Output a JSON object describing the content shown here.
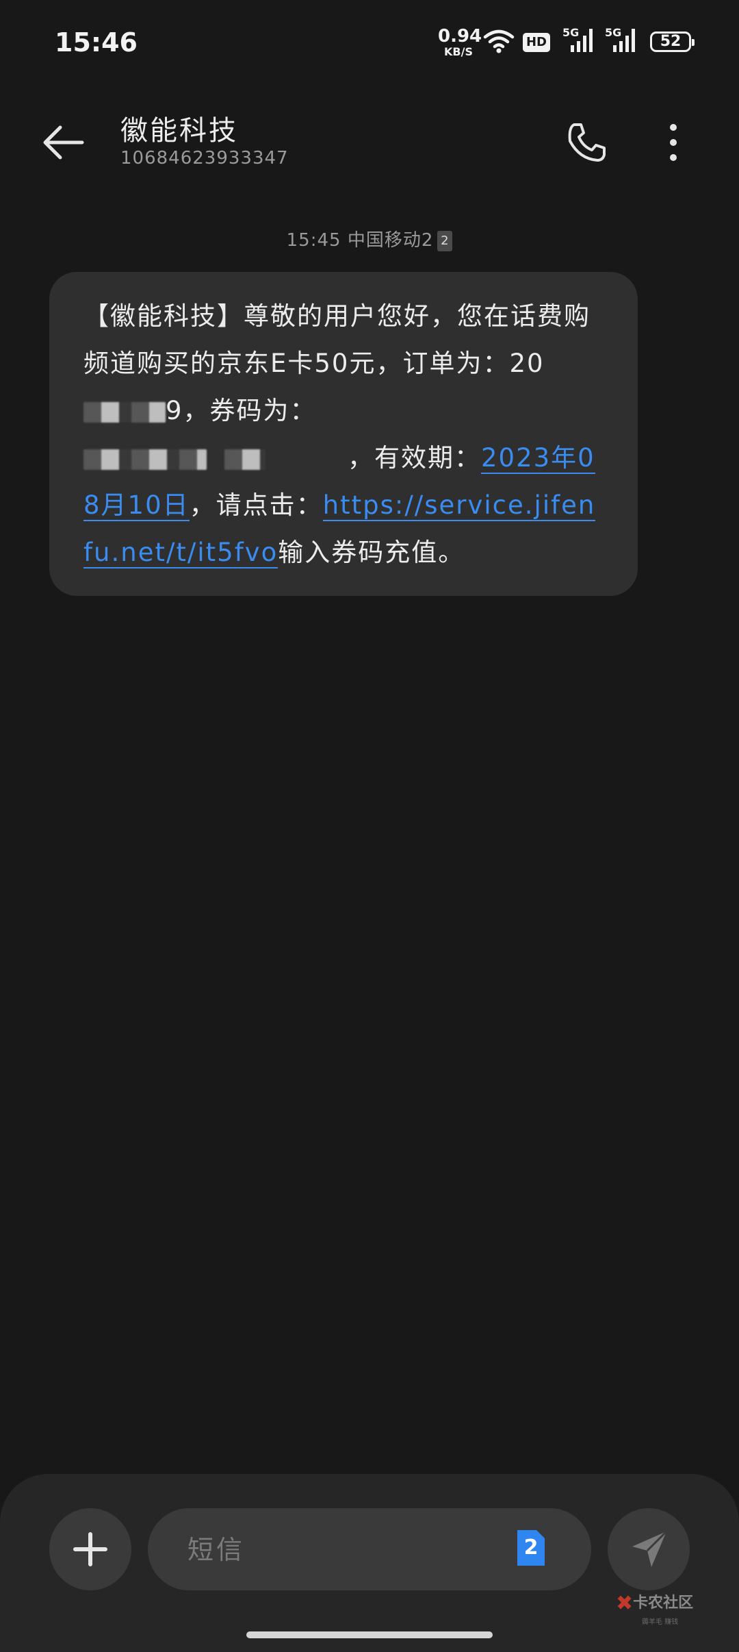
{
  "status_bar": {
    "time": "15:46",
    "net_speed_value": "0.94",
    "net_speed_unit": "KB/S",
    "hd_label": "HD",
    "sim1_label": "5G",
    "sim2_label": "5G",
    "battery": "52",
    "icons": [
      "wifi-icon",
      "hd-icon",
      "signal-5g-icon",
      "signal-5g-icon",
      "battery-icon"
    ]
  },
  "header": {
    "title": "徽能科技",
    "number": "10684623933347",
    "icons": [
      "back-arrow-icon",
      "phone-icon",
      "more-vertical-icon"
    ]
  },
  "conversation": {
    "meta_time": "15:45",
    "meta_carrier": "中国移动2",
    "meta_sim": "2",
    "message": {
      "part1": "【徽能科技】尊敬的用户您好，您在话费购频道购买的京东E卡50元，订单为：20",
      "part2": "9，券码为：",
      "part3": "，有效期：",
      "date_link": "2023年08月10日",
      "part4": "，请点击：",
      "url": "https://service.jifenfu.net/t/it5fvo",
      "part5": "输入券码充值。"
    }
  },
  "composer": {
    "placeholder": "短信",
    "sim_badge": "2",
    "icons": [
      "plus-icon",
      "sim-card-icon",
      "send-icon"
    ]
  },
  "watermark": {
    "text": "卡农社区",
    "sub": "薅羊毛 赚钱"
  },
  "colors": {
    "background": "#181818",
    "bubble": "#2f2f2f",
    "link": "#3a8cf0",
    "sim_badge": "#2f86f0"
  }
}
